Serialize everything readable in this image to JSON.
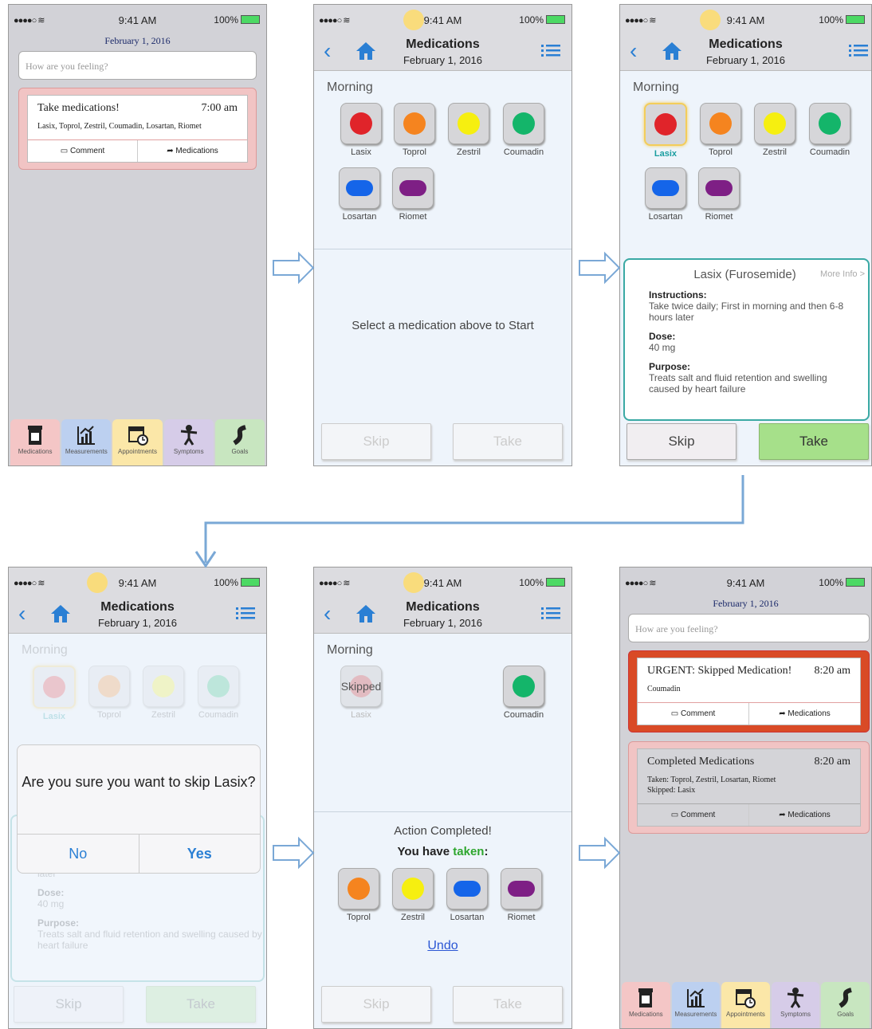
{
  "status": {
    "time": "9:41 AM",
    "battery": "100%",
    "signal": "●●●●○ ≋"
  },
  "date": "February 1, 2016",
  "feel_placeholder": "How are you feeling?",
  "tabs": [
    "Medications",
    "Measurements",
    "Appointments",
    "Symptoms",
    "Goals"
  ],
  "tab_colors": [
    "#f4c6c6",
    "#bcd0f0",
    "#fbe7a8",
    "#d6cce8",
    "#c8e6c0"
  ],
  "screen1": {
    "card_title": "Take medications!",
    "card_time": "7:00 am",
    "card_body": "Lasix, Toprol, Zestril, Coumadin, Losartan, Riomet",
    "comment": "Comment",
    "medications": "Medications"
  },
  "nav": {
    "title": "Medications",
    "subtitle": "February 1, 2016"
  },
  "section": "Morning",
  "meds": [
    {
      "name": "Lasix",
      "color": "#e0242a",
      "shape": "dot"
    },
    {
      "name": "Toprol",
      "color": "#f5841f",
      "shape": "dot"
    },
    {
      "name": "Zestril",
      "color": "#f6ef10",
      "shape": "dot"
    },
    {
      "name": "Coumadin",
      "color": "#14b56a",
      "shape": "dot"
    },
    {
      "name": "Losartan",
      "color": "#1565e9",
      "shape": "bar"
    },
    {
      "name": "Riomet",
      "color": "#7e1f85",
      "shape": "bar"
    }
  ],
  "select_prompt": "Select a medication above to Start",
  "skip": "Skip",
  "take": "Take",
  "popup": {
    "title": "Lasix (Furosemide)",
    "more": "More Info >",
    "instructions_k": "Instructions:",
    "instructions_v": "Take twice daily; First in morning and then 6-8 hours later",
    "dose_k": "Dose:",
    "dose_v": "40 mg",
    "purpose_k": "Purpose:",
    "purpose_v": "Treats salt and fluid retention and swelling caused by heart failure"
  },
  "dialog": {
    "question": "Are you sure you want to skip Lasix?",
    "no": "No",
    "yes": "Yes"
  },
  "screen5": {
    "skipped": "Skipped",
    "action": "Action Completed!",
    "you_have": "You have",
    "taken": "taken",
    "colon": ":",
    "undo": "Undo"
  },
  "screen6": {
    "urgent_title": "URGENT: Skipped Medication!",
    "urgent_time": "8:20 am",
    "urgent_body": "Coumadin",
    "done_title": "Completed Medications",
    "done_time": "8:20 am",
    "done_taken": "Taken:   Toprol, Zestril, Losartan, Riomet",
    "done_skipped": "Skipped:  Lasix"
  }
}
